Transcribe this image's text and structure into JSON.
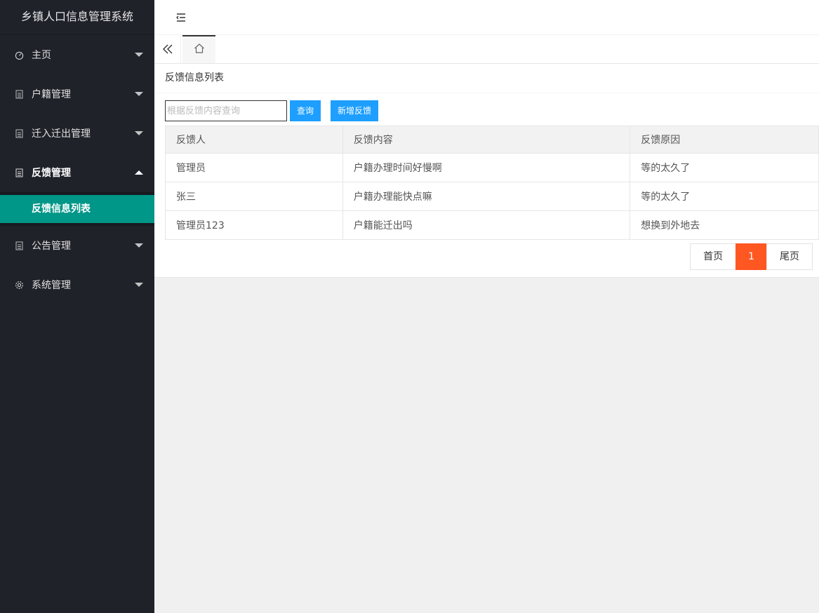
{
  "app": {
    "title": "乡镇人口信息管理系统"
  },
  "sidebar": {
    "items": [
      {
        "label": "主页",
        "icon": "dashboard-icon"
      },
      {
        "label": "户籍管理",
        "icon": "document-icon"
      },
      {
        "label": "迁入迁出管理",
        "icon": "document-icon"
      },
      {
        "label": "反馈管理",
        "icon": "document-icon",
        "expanded": true,
        "children": [
          {
            "label": "反馈信息列表",
            "active": true
          }
        ]
      },
      {
        "label": "公告管理",
        "icon": "document-icon"
      },
      {
        "label": "系统管理",
        "icon": "gear-icon"
      }
    ]
  },
  "header": {
    "menu_icon": "menu-fold-icon"
  },
  "tabs": {
    "prev_icon": "double-chevron-left-icon",
    "home_icon": "home-icon"
  },
  "main": {
    "title": "反馈信息列表",
    "search": {
      "placeholder": "根据反馈内容查询",
      "value": ""
    },
    "query_button": "查询",
    "add_button": "新增反馈",
    "table": {
      "columns": [
        "反馈人",
        "反馈内容",
        "反馈原因"
      ],
      "rows": [
        [
          "管理员",
          "户籍办理时间好慢啊",
          "等的太久了"
        ],
        [
          "张三",
          "户籍办理能快点嘛",
          "等的太久了"
        ],
        [
          "管理员123",
          "户籍能迁出吗",
          "想换到外地去"
        ]
      ]
    },
    "pager": {
      "first": "首页",
      "current": "1",
      "last": "尾页"
    }
  },
  "colors": {
    "sidebar_bg": "#20222a",
    "active_teal": "#009688",
    "button_blue": "#1e9fff",
    "pager_orange": "#ff5722"
  }
}
